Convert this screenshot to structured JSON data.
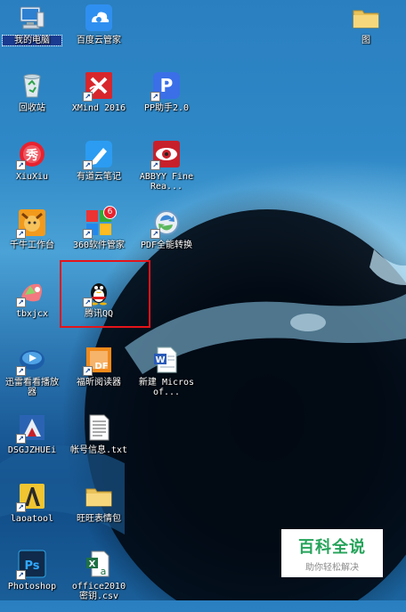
{
  "desktop_icons": [
    {
      "id": "my-computer",
      "label": "我的电脑",
      "icon": "computer-icon",
      "selected": true,
      "shortcut": false
    },
    {
      "id": "baidu-cloud",
      "label": "百度云管家",
      "icon": "baidu-cloud-icon",
      "shortcut": false
    },
    {
      "id": "folder",
      "label": "图",
      "icon": "folder-icon",
      "shortcut": false
    },
    {
      "id": "recycle-bin",
      "label": "回收站",
      "icon": "recycle-bin-icon",
      "shortcut": false
    },
    {
      "id": "xmind",
      "label": "XMind 2016",
      "icon": "xmind-icon",
      "shortcut": true
    },
    {
      "id": "pp-assistant",
      "label": "PP助手2.0",
      "icon": "pp-icon",
      "shortcut": true
    },
    {
      "id": "xiuxiu",
      "label": "XiuXiu",
      "icon": "xiuxiu-icon",
      "shortcut": true
    },
    {
      "id": "youdao-note",
      "label": "有道云笔记",
      "icon": "youdao-note-icon",
      "shortcut": true
    },
    {
      "id": "abbyy",
      "label": "ABBYY FineRea...",
      "icon": "abbyy-eye-icon",
      "shortcut": true
    },
    {
      "id": "qianniu",
      "label": "千牛工作台",
      "icon": "qianniu-icon",
      "shortcut": true
    },
    {
      "id": "360-software",
      "label": "360软件管家",
      "icon": "360-software-icon",
      "shortcut": true,
      "badge": "6"
    },
    {
      "id": "pdf-converter",
      "label": "PDF全能转换",
      "icon": "pdf-convert-icon",
      "shortcut": true
    },
    {
      "id": "tbxjcx",
      "label": "tbxjcx",
      "icon": "tbxjcx-icon",
      "shortcut": true
    },
    {
      "id": "tencent-qq",
      "label": "腾讯QQ",
      "icon": "qq-penguin-icon",
      "shortcut": true
    },
    {
      "id": "xunlei-player",
      "label": "迅雷看看播放器",
      "icon": "xunlei-player-icon",
      "shortcut": true
    },
    {
      "id": "foxit-reader",
      "label": "福昕阅读器",
      "icon": "foxit-pdf-icon",
      "shortcut": true
    },
    {
      "id": "new-word-doc",
      "label": "新建 Microsof...",
      "icon": "word-doc-icon",
      "shortcut": false
    },
    {
      "id": "dsgjzhuei",
      "label": "DSGJZHUEi",
      "icon": "dsg-icon",
      "shortcut": true
    },
    {
      "id": "account-info",
      "label": "帐号信息.txt",
      "icon": "text-file-icon",
      "shortcut": false
    },
    {
      "id": "laoatool",
      "label": "laoatool",
      "icon": "laoatool-icon",
      "shortcut": true
    },
    {
      "id": "wangwang-emoji",
      "label": "旺旺表情包",
      "icon": "folder-icon",
      "shortcut": false
    },
    {
      "id": "photoshop",
      "label": "Photoshop",
      "icon": "photoshop-icon",
      "shortcut": true
    },
    {
      "id": "office-excel",
      "label": "office2010 密钥.csv",
      "icon": "excel-file-icon",
      "shortcut": false
    }
  ],
  "watermark": {
    "title": "百科全说",
    "subtitle": "助你轻松解决",
    "color": "#25a35a"
  },
  "highlight_target": "腾讯QQ"
}
